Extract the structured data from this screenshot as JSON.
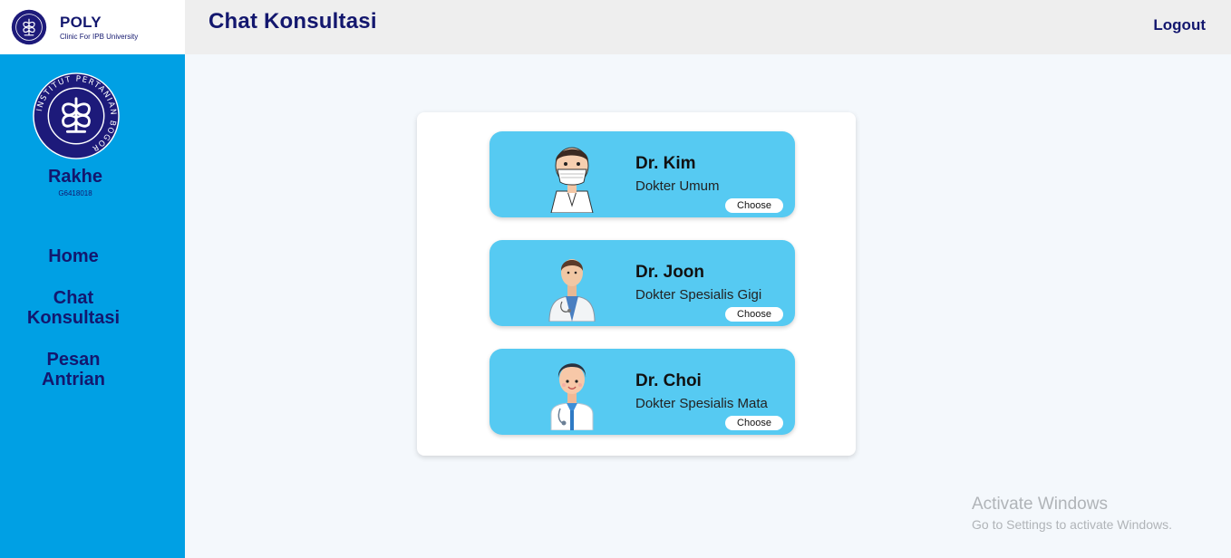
{
  "brand": {
    "title": "POLY",
    "subtitle": "Clinic For IPB University",
    "logo_icon": "ipb-seal-icon"
  },
  "header": {
    "title": "Chat Konsultasi",
    "logout_label": "Logout"
  },
  "user": {
    "name": "Rakhe",
    "id": "G6418018",
    "avatar_icon": "ipb-seal-icon",
    "avatar_text": "INSTITUT PERTANIAN BOGOR"
  },
  "nav": [
    {
      "line1": "Home",
      "line2": ""
    },
    {
      "line1": "Chat",
      "line2": "Konsultasi"
    },
    {
      "line1": "Pesan",
      "line2": "Antrian"
    }
  ],
  "doctors": [
    {
      "name": "Dr. Kim",
      "specialty": "Dokter Umum",
      "button_label": "Choose",
      "illustration": "doctor-masked-icon"
    },
    {
      "name": "Dr. Joon",
      "specialty": "Dokter Spesialis Gigi",
      "button_label": "Choose",
      "illustration": "doctor-female-icon"
    },
    {
      "name": "Dr. Choi",
      "specialty": "Dokter Spesialis Mata",
      "button_label": "Choose",
      "illustration": "doctor-male-icon"
    }
  ],
  "watermark": {
    "title": "Activate Windows",
    "subtitle": "Go to Settings to activate Windows."
  },
  "colors": {
    "sidebar": "#00a0e4",
    "header": "#eeeeee",
    "accent_text": "#13176e",
    "card": "#56caf2"
  }
}
